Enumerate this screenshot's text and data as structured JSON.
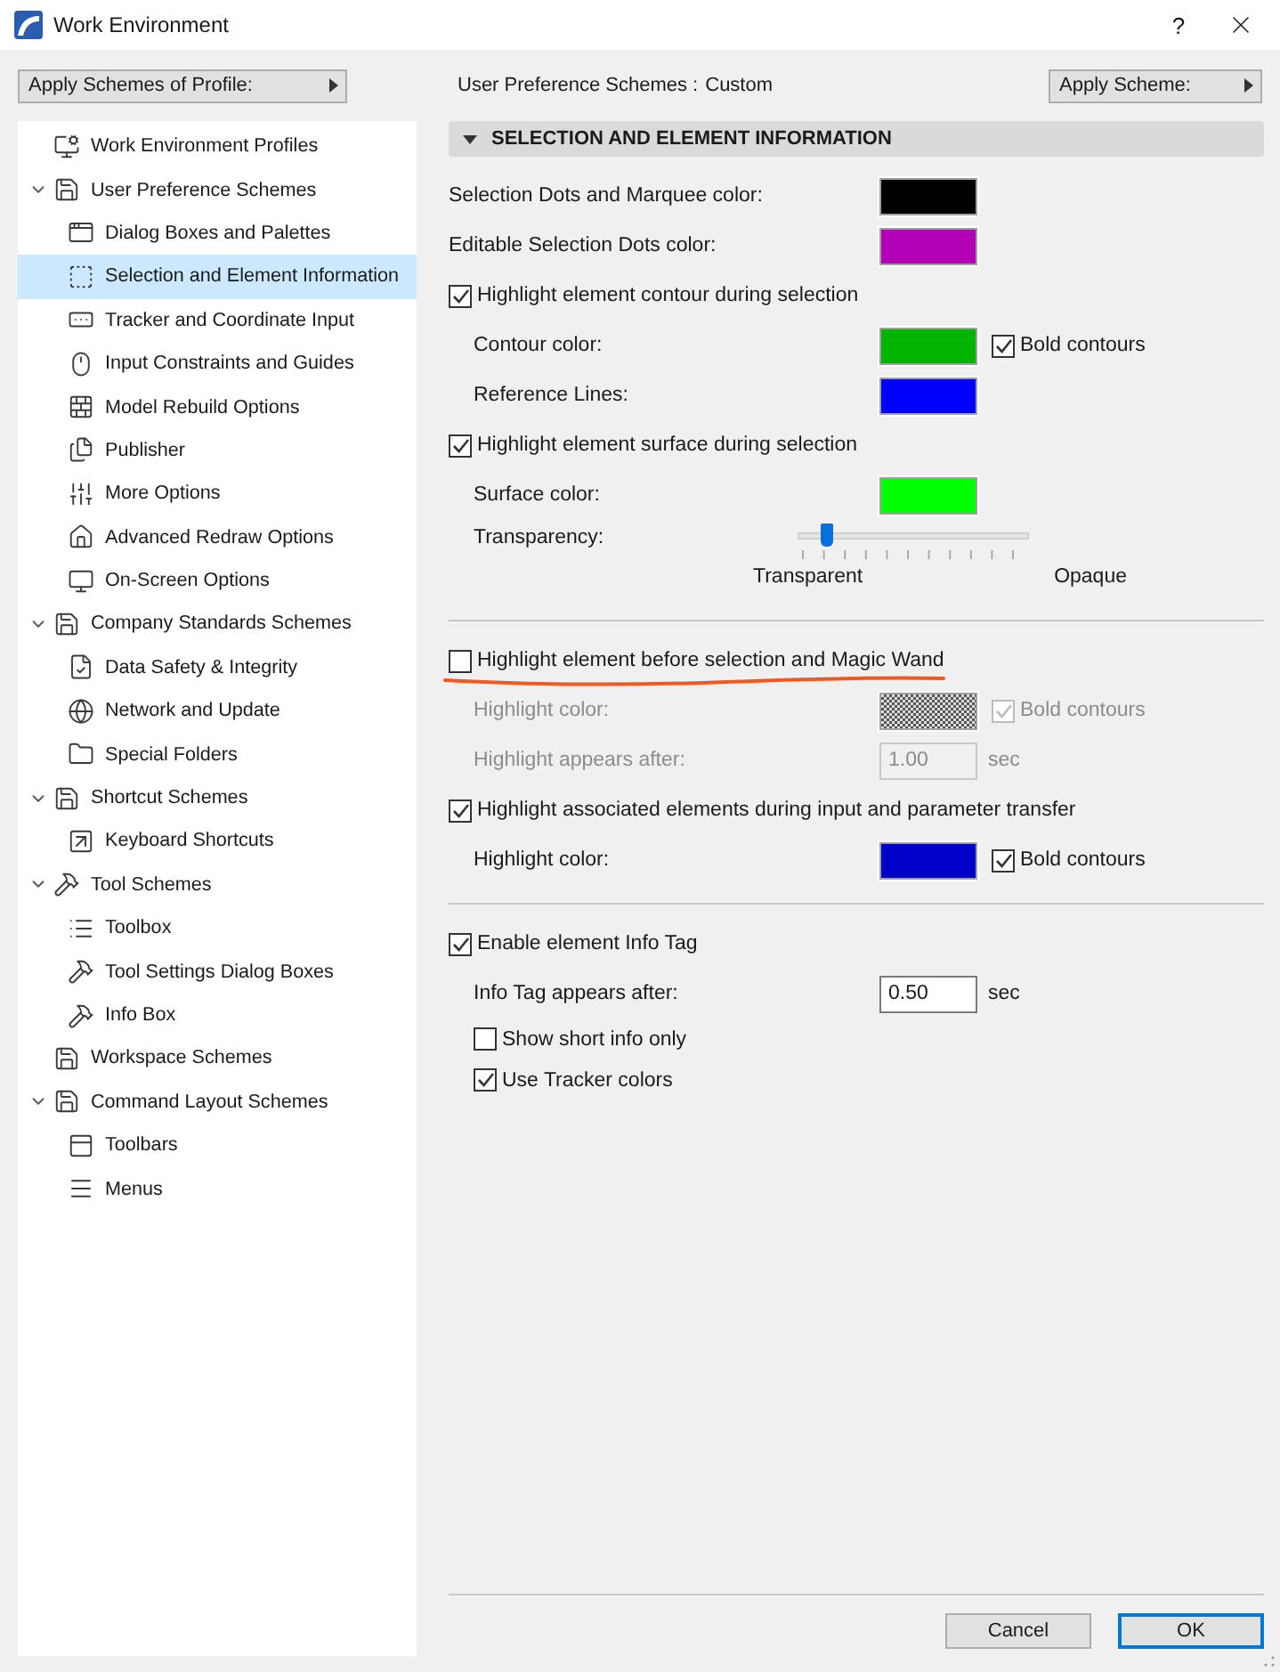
{
  "window": {
    "title": "Work Environment",
    "help": "?"
  },
  "top_bar": {
    "profile_button": "Apply Schemes of Profile:",
    "scheme_label": "User Preference Schemes :",
    "scheme_value": "Custom",
    "apply_button": "Apply Scheme:"
  },
  "tree": [
    {
      "label": "Work Environment Profiles",
      "selected": false
    },
    {
      "label": "User Preference Schemes",
      "selected": false,
      "expanded": true,
      "children": [
        {
          "label": "Dialog Boxes and Palettes",
          "selected": false
        },
        {
          "label": "Selection and Element Information",
          "selected": true
        },
        {
          "label": "Tracker and Coordinate Input",
          "selected": false
        },
        {
          "label": "Input Constraints and Guides",
          "selected": false
        },
        {
          "label": "Model Rebuild Options",
          "selected": false
        },
        {
          "label": "Publisher",
          "selected": false
        },
        {
          "label": "More Options",
          "selected": false
        },
        {
          "label": "Advanced Redraw Options",
          "selected": false
        },
        {
          "label": "On-Screen Options",
          "selected": false
        }
      ]
    },
    {
      "label": "Company Standards Schemes",
      "selected": false,
      "expanded": true,
      "children": [
        {
          "label": "Data Safety & Integrity",
          "selected": false
        },
        {
          "label": "Network and Update",
          "selected": false
        },
        {
          "label": "Special Folders",
          "selected": false
        }
      ]
    },
    {
      "label": "Shortcut Schemes",
      "selected": false,
      "expanded": true,
      "children": [
        {
          "label": "Keyboard Shortcuts",
          "selected": false
        }
      ]
    },
    {
      "label": "Tool Schemes",
      "selected": false,
      "expanded": true,
      "children": [
        {
          "label": "Toolbox",
          "selected": false
        },
        {
          "label": "Tool Settings Dialog Boxes",
          "selected": false
        },
        {
          "label": "Info Box",
          "selected": false
        }
      ]
    },
    {
      "label": "Workspace Schemes",
      "selected": false
    },
    {
      "label": "Command Layout Schemes",
      "selected": false,
      "expanded": true,
      "children": [
        {
          "label": "Toolbars",
          "selected": false
        },
        {
          "label": "Menus",
          "selected": false
        }
      ]
    }
  ],
  "panel": {
    "title": "SELECTION AND ELEMENT INFORMATION",
    "expanded": true,
    "sections": [
      {
        "items": [
          {
            "kind": "color",
            "label": "Selection Dots and Marquee color:",
            "color": "#000000"
          },
          {
            "kind": "color",
            "label": "Editable Selection Dots color:",
            "color": "#b400b4"
          },
          {
            "kind": "check",
            "label": "Highlight element contour during selection",
            "checked": true,
            "children": [
              {
                "kind": "color",
                "label": "Contour color:",
                "color": "#00b400",
                "bold": {
                  "label": "Bold contours",
                  "checked": true
                }
              },
              {
                "kind": "color",
                "label": "Reference Lines:",
                "color": "#0000ff"
              }
            ]
          },
          {
            "kind": "check",
            "label": "Highlight element surface during selection",
            "checked": true,
            "children": [
              {
                "kind": "color",
                "label": "Surface color:",
                "color": "#00ff00"
              },
              {
                "kind": "slider",
                "label": "Transparency:",
                "level": 0.12,
                "min_label": "Transparent",
                "max_label": "Opaque"
              }
            ]
          }
        ]
      },
      {
        "items": [
          {
            "kind": "check",
            "label": "Highlight element before selection and Magic Wand",
            "checked": false,
            "underlined": true,
            "children": [
              {
                "kind": "pattern",
                "label": "Highlight color:",
                "bold": {
                  "label": "Bold contours",
                  "checked": true
                }
              },
              {
                "kind": "number",
                "label": "Highlight appears after:",
                "value": "1.00",
                "unit": "sec"
              }
            ]
          },
          {
            "kind": "check",
            "label": "Highlight associated elements during input and parameter transfer",
            "checked": true,
            "children": [
              {
                "kind": "color",
                "label": "Highlight color:",
                "color": "#0000c8",
                "bold": {
                  "label": "Bold contours",
                  "checked": true
                }
              }
            ]
          }
        ]
      },
      {
        "items": [
          {
            "kind": "check",
            "label": "Enable element Info Tag",
            "checked": true,
            "children": [
              {
                "kind": "number",
                "label": "Info Tag appears after:",
                "value": "0.50",
                "unit": "sec"
              },
              {
                "kind": "check",
                "label": "Show short info only",
                "checked": false
              },
              {
                "kind": "check",
                "label": "Use Tracker colors",
                "checked": true
              }
            ]
          }
        ]
      }
    ]
  },
  "buttons": [
    {
      "label": "Cancel",
      "default": false
    },
    {
      "label": "OK",
      "default": true
    }
  ]
}
